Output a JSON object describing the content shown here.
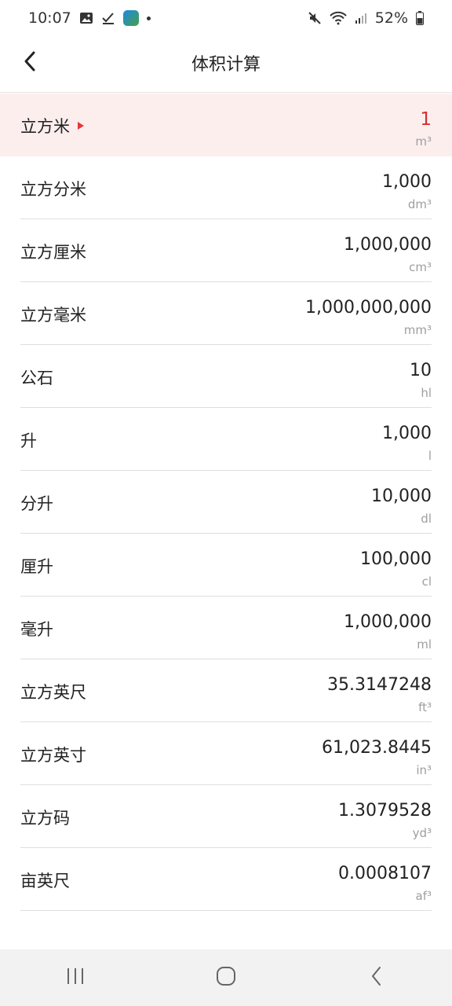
{
  "status_bar": {
    "time": "10:07",
    "battery": "52%"
  },
  "header": {
    "title": "体积计算"
  },
  "units": [
    {
      "name": "立方米",
      "value": "1",
      "symbol": "m³",
      "active": true
    },
    {
      "name": "立方分米",
      "value": "1,000",
      "symbol": "dm³"
    },
    {
      "name": "立方厘米",
      "value": "1,000,000",
      "symbol": "cm³"
    },
    {
      "name": "立方毫米",
      "value": "1,000,000,000",
      "symbol": "mm³"
    },
    {
      "name": "公石",
      "value": "10",
      "symbol": "hl"
    },
    {
      "name": "升",
      "value": "1,000",
      "symbol": "l"
    },
    {
      "name": "分升",
      "value": "10,000",
      "symbol": "dl"
    },
    {
      "name": "厘升",
      "value": "100,000",
      "symbol": "cl"
    },
    {
      "name": "毫升",
      "value": "1,000,000",
      "symbol": "ml"
    },
    {
      "name": "立方英尺",
      "value": "35.3147248",
      "symbol": "ft³"
    },
    {
      "name": "立方英寸",
      "value": "61,023.8445",
      "symbol": "in³"
    },
    {
      "name": "立方码",
      "value": "1.3079528",
      "symbol": "yd³"
    },
    {
      "name": "亩英尺",
      "value": "0.0008107",
      "symbol": "af³"
    }
  ],
  "colors": {
    "active_bg": "#fdeeee",
    "active_value": "#d32f2f",
    "marker": "#e53935"
  },
  "nav_bar": {
    "icons": [
      "recent-apps-icon",
      "home-icon",
      "back-icon"
    ]
  }
}
